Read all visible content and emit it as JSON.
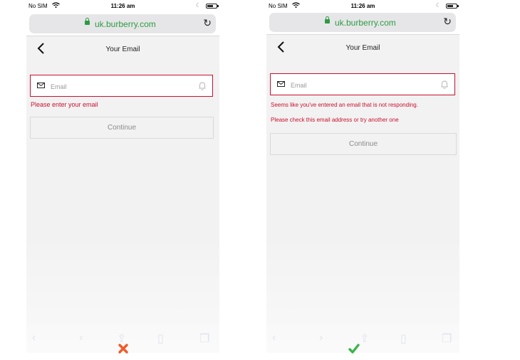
{
  "status_bar": {
    "carrier": "No SIM",
    "time": "11:26 am"
  },
  "browser": {
    "url": "uk.burberry.com"
  },
  "nav": {
    "title": "Your Email"
  },
  "form": {
    "email_placeholder": "Email",
    "continue_label": "Continue"
  },
  "left_screen": {
    "error": "Please enter your email",
    "verdict_icon": "cross-icon"
  },
  "right_screen": {
    "error_line1": "Seems like you've entered an email that is not responding.",
    "error_line2": "Please check this email address or try another one",
    "verdict_icon": "check-icon"
  },
  "colors": {
    "error_red": "#c8102e",
    "url_green": "#2e9b43",
    "cross_orange": "#f05a28",
    "check_green": "#3cb54a"
  }
}
